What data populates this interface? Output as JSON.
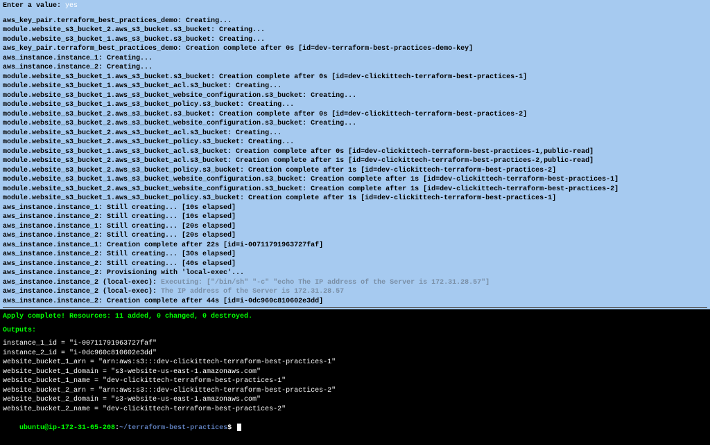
{
  "prompt": {
    "label": "  Enter a value: ",
    "input": "yes"
  },
  "top_lines": [
    {
      "t": "aws_key_pair.terraform_best_practices_demo: Creating..."
    },
    {
      "t": "module.website_s3_bucket_2.aws_s3_bucket.s3_bucket: Creating..."
    },
    {
      "t": "module.website_s3_bucket_1.aws_s3_bucket.s3_bucket: Creating..."
    },
    {
      "t": "aws_key_pair.terraform_best_practices_demo: Creation complete after 0s [id=dev-terraform-best-practices-demo-key]"
    },
    {
      "t": "aws_instance.instance_1: Creating..."
    },
    {
      "t": "aws_instance.instance_2: Creating..."
    },
    {
      "t": "module.website_s3_bucket_1.aws_s3_bucket.s3_bucket: Creation complete after 0s [id=dev-clickittech-terraform-best-practices-1]"
    },
    {
      "t": "module.website_s3_bucket_1.aws_s3_bucket_acl.s3_bucket: Creating..."
    },
    {
      "t": "module.website_s3_bucket_1.aws_s3_bucket_website_configuration.s3_bucket: Creating..."
    },
    {
      "t": "module.website_s3_bucket_1.aws_s3_bucket_policy.s3_bucket: Creating..."
    },
    {
      "t": "module.website_s3_bucket_2.aws_s3_bucket.s3_bucket: Creation complete after 0s [id=dev-clickittech-terraform-best-practices-2]"
    },
    {
      "t": "module.website_s3_bucket_2.aws_s3_bucket_website_configuration.s3_bucket: Creating..."
    },
    {
      "t": "module.website_s3_bucket_2.aws_s3_bucket_acl.s3_bucket: Creating..."
    },
    {
      "t": "module.website_s3_bucket_2.aws_s3_bucket_policy.s3_bucket: Creating..."
    },
    {
      "t": "module.website_s3_bucket_1.aws_s3_bucket_acl.s3_bucket: Creation complete after 0s [id=dev-clickittech-terraform-best-practices-1,public-read]"
    },
    {
      "t": "module.website_s3_bucket_2.aws_s3_bucket_acl.s3_bucket: Creation complete after 1s [id=dev-clickittech-terraform-best-practices-2,public-read]"
    },
    {
      "t": "module.website_s3_bucket_2.aws_s3_bucket_policy.s3_bucket: Creation complete after 1s [id=dev-clickittech-terraform-best-practices-2]"
    },
    {
      "t": "module.website_s3_bucket_1.aws_s3_bucket_website_configuration.s3_bucket: Creation complete after 1s [id=dev-clickittech-terraform-best-practices-1]"
    },
    {
      "t": "module.website_s3_bucket_2.aws_s3_bucket_website_configuration.s3_bucket: Creation complete after 1s [id=dev-clickittech-terraform-best-practices-2]"
    },
    {
      "t": "module.website_s3_bucket_1.aws_s3_bucket_policy.s3_bucket: Creation complete after 1s [id=dev-clickittech-terraform-best-practices-1]"
    },
    {
      "t": "aws_instance.instance_1: Still creating... [10s elapsed]"
    },
    {
      "t": "aws_instance.instance_2: Still creating... [10s elapsed]"
    },
    {
      "t": "aws_instance.instance_1: Still creating... [20s elapsed]"
    },
    {
      "t": "aws_instance.instance_2: Still creating... [20s elapsed]"
    },
    {
      "t": "aws_instance.instance_1: Creation complete after 22s [id=i-00711791963727faf]"
    },
    {
      "t": "aws_instance.instance_2: Still creating... [30s elapsed]"
    },
    {
      "t": "aws_instance.instance_2: Still creating... [40s elapsed]"
    },
    {
      "t": "aws_instance.instance_2: Provisioning with 'local-exec'..."
    },
    {
      "pre": "aws_instance.instance_2 (local-exec): ",
      "light": "Executing: [\"/bin/sh\" \"-c\" \"echo The IP address of the Server is 172.31.28.57\"]"
    },
    {
      "pre": "aws_instance.instance_2 (local-exec): ",
      "light": "The IP address of the Server is 172.31.28.57"
    },
    {
      "t": "aws_instance.instance_2: Creation complete after 44s [id=i-0dc960c810602e3dd]"
    }
  ],
  "apply_complete": "Apply complete! Resources: 11 added, 0 changed, 0 destroyed.",
  "outputs_header": "Outputs:",
  "outputs": [
    "instance_1_id = \"i-00711791963727faf\"",
    "instance_2_id = \"i-0dc960c810602e3dd\"",
    "website_bucket_1_arn = \"arn:aws:s3:::dev-clickittech-terraform-best-practices-1\"",
    "website_bucket_1_domain = \"s3-website-us-east-1.amazonaws.com\"",
    "website_bucket_1_name = \"dev-clickittech-terraform-best-practices-1\"",
    "website_bucket_2_arn = \"arn:aws:s3:::dev-clickittech-terraform-best-practices-2\"",
    "website_bucket_2_domain = \"s3-website-us-east-1.amazonaws.com\"",
    "website_bucket_2_name = \"dev-clickittech-terraform-best-practices-2\""
  ],
  "shell": {
    "user_host": "ubuntu@ip-172-31-65-208",
    "colon": ":",
    "path": "~/terraform-best-practices",
    "dollar": "$"
  }
}
